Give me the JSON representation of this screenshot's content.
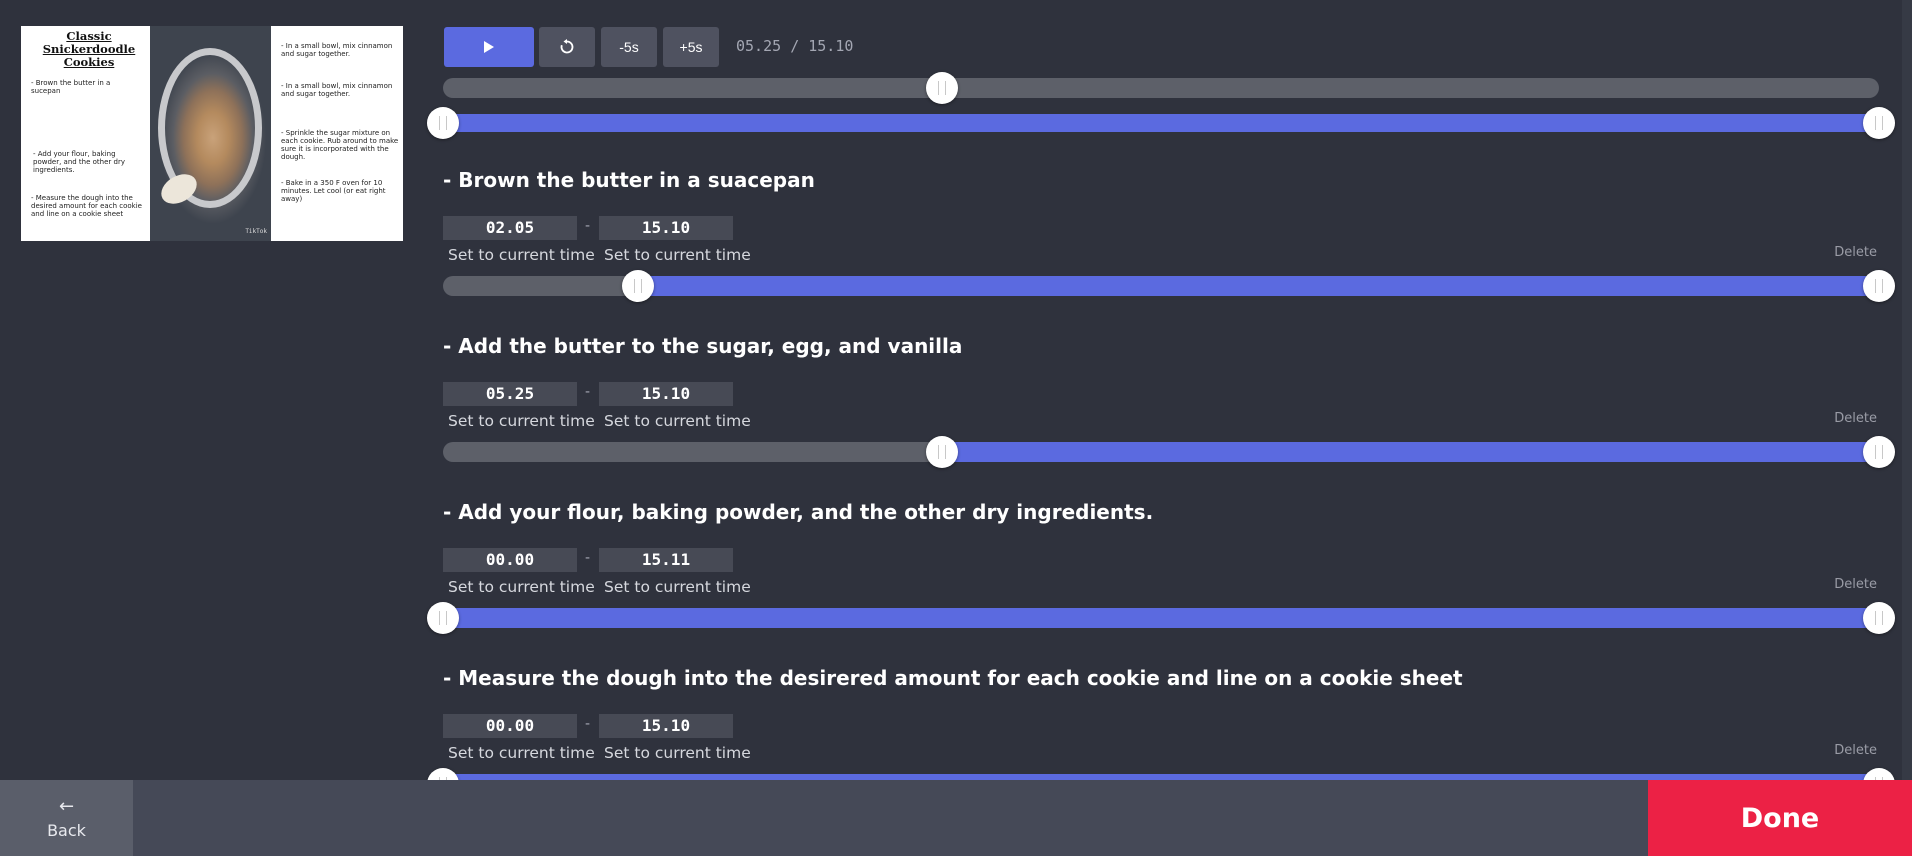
{
  "preview": {
    "title": "Classic Snickerdoodle\nCookies",
    "left_notes": [
      "- Brown the butter in a sucepan",
      "- Add your flour, baking powder, and the other dry ingredients.",
      "- Measure the dough into the desired amount for each cookie and line on a cookie sheet"
    ],
    "right_notes": [
      "- In a small bowl, mix cinnamon and sugar together.",
      "- In a small bowl, mix cinnamon and sugar together.",
      "- Sprinkle the sugar mixture on each cookie. Rub around to make sure it is incorporated with the dough.",
      "- Bake in a 350 F oven for 10 minutes. Let cool (or eat right away)"
    ],
    "watermark": "TikTok"
  },
  "player": {
    "minus_label": "-5s",
    "plus_label": "+5s",
    "current_time": "05.25",
    "separator": "/",
    "total_time": "15.10",
    "progress": 0.3476
  },
  "top_partial_range": {
    "start": 0.0,
    "end": 1.0
  },
  "steps": [
    {
      "title": "- Brown the butter in a suacepan",
      "start": "02.05",
      "end": "15.10",
      "set_start": "Set to current time",
      "set_end": "Set to current time",
      "delete": "Delete"
    },
    {
      "title": "- Add the butter to the sugar, egg, and vanilla",
      "start": "05.25",
      "end": "15.10",
      "set_start": "Set to current time",
      "set_end": "Set to current time",
      "delete": "Delete"
    },
    {
      "title": "- Add your flour, baking powder, and the other dry ingredients.",
      "start": "00.00",
      "end": "15.11",
      "set_start": "Set to current time",
      "set_end": "Set to current time",
      "delete": "Delete"
    },
    {
      "title": "- Measure the dough into the desirered amount for each cookie and line on a cookie sheet",
      "start": "00.00",
      "end": "15.10",
      "set_start": "Set to current time",
      "set_end": "Set to current time",
      "delete": "Delete"
    }
  ],
  "footer": {
    "back_label": "Back",
    "done_label": "Done"
  },
  "colors": {
    "accent": "#5b6ae0",
    "done": "#ec2145",
    "background": "#2f323d"
  },
  "icons": {
    "play": "play-icon",
    "restart": "restart-icon",
    "back": "arrow-left-icon"
  }
}
